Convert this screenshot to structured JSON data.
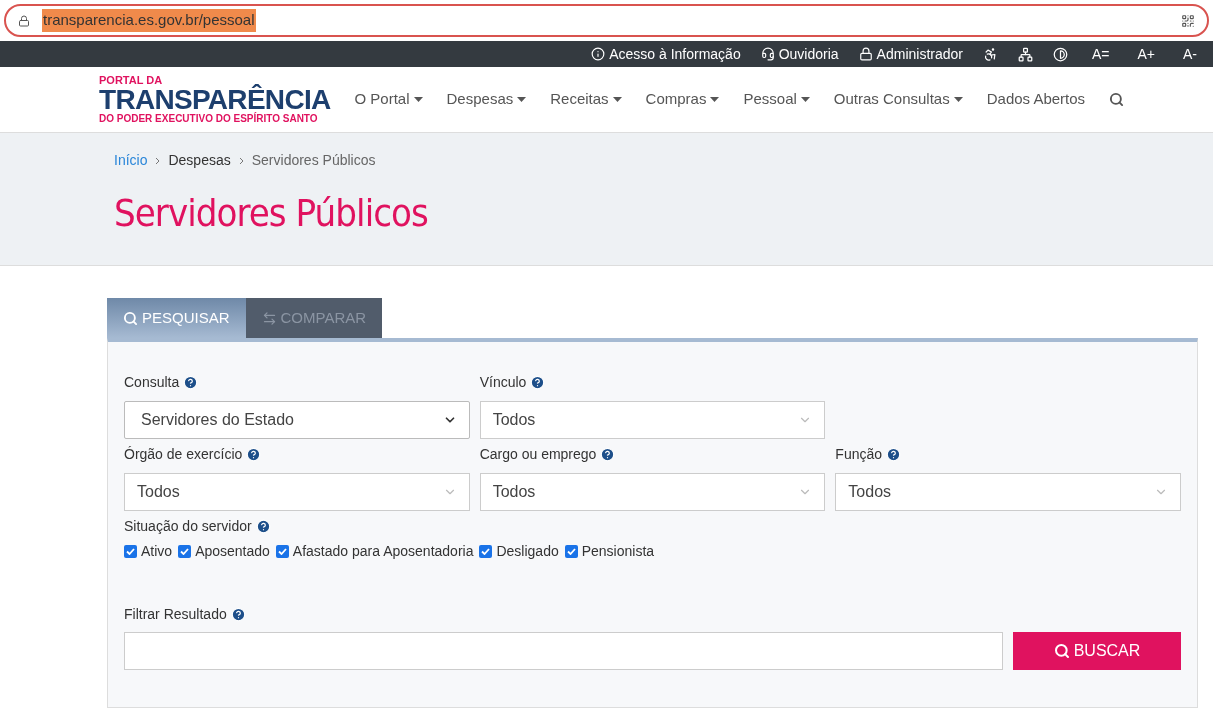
{
  "browser": {
    "url": "transparencia.es.gov.br/pessoal"
  },
  "topbar": {
    "links": [
      {
        "kind": "info",
        "label": "Acesso à Informação"
      },
      {
        "kind": "headset",
        "label": "Ouvidoria"
      },
      {
        "kind": "lock",
        "label": "Administrador"
      }
    ],
    "font_buttons": [
      "A=",
      "A+",
      "A-"
    ]
  },
  "logo": {
    "top": "PORTAL DA",
    "main": "TRANSPARÊNCIA",
    "bottom": "DO PODER EXECUTIVO DO ESPÍRITO SANTO"
  },
  "nav": [
    {
      "label": "O Portal",
      "dropdown": true
    },
    {
      "label": "Despesas",
      "dropdown": true
    },
    {
      "label": "Receitas",
      "dropdown": true
    },
    {
      "label": "Compras",
      "dropdown": true
    },
    {
      "label": "Pessoal",
      "dropdown": true
    },
    {
      "label": "Outras Consultas",
      "dropdown": true
    },
    {
      "label": "Dados Abertos",
      "dropdown": false
    }
  ],
  "breadcrumb": [
    {
      "label": "Início",
      "link": true
    },
    {
      "label": "Despesas",
      "link": false
    },
    {
      "label": "Servidores Públicos",
      "link": false
    }
  ],
  "page_title": "Servidores Públicos",
  "tabs": [
    {
      "label": "PESQUISAR",
      "kind": "search",
      "selected": true
    },
    {
      "label": "COMPARAR",
      "kind": "compare",
      "selected": false
    }
  ],
  "field_rows": [
    [
      {
        "label": "Consulta",
        "value": "Servidores do Estado",
        "kind": "native"
      },
      {
        "label": "Vínculo",
        "value": "Todos",
        "kind": "styled"
      }
    ],
    [
      {
        "label": "Órgão de exercício",
        "value": "Todos",
        "kind": "styled"
      },
      {
        "label": "Cargo ou emprego",
        "value": "Todos",
        "kind": "styled"
      },
      {
        "label": "Função",
        "value": "Todos",
        "kind": "styled"
      }
    ]
  ],
  "situacao": {
    "label": "Situação do servidor",
    "options": [
      {
        "label": "Ativo",
        "checked": true
      },
      {
        "label": "Aposentado",
        "checked": true
      },
      {
        "label": "Afastado para Aposentadoria",
        "checked": true
      },
      {
        "label": "Desligado",
        "checked": true
      },
      {
        "label": "Pensionista",
        "checked": true
      }
    ]
  },
  "filter": {
    "label": "Filtrar Resultado",
    "button": "BUSCAR"
  }
}
